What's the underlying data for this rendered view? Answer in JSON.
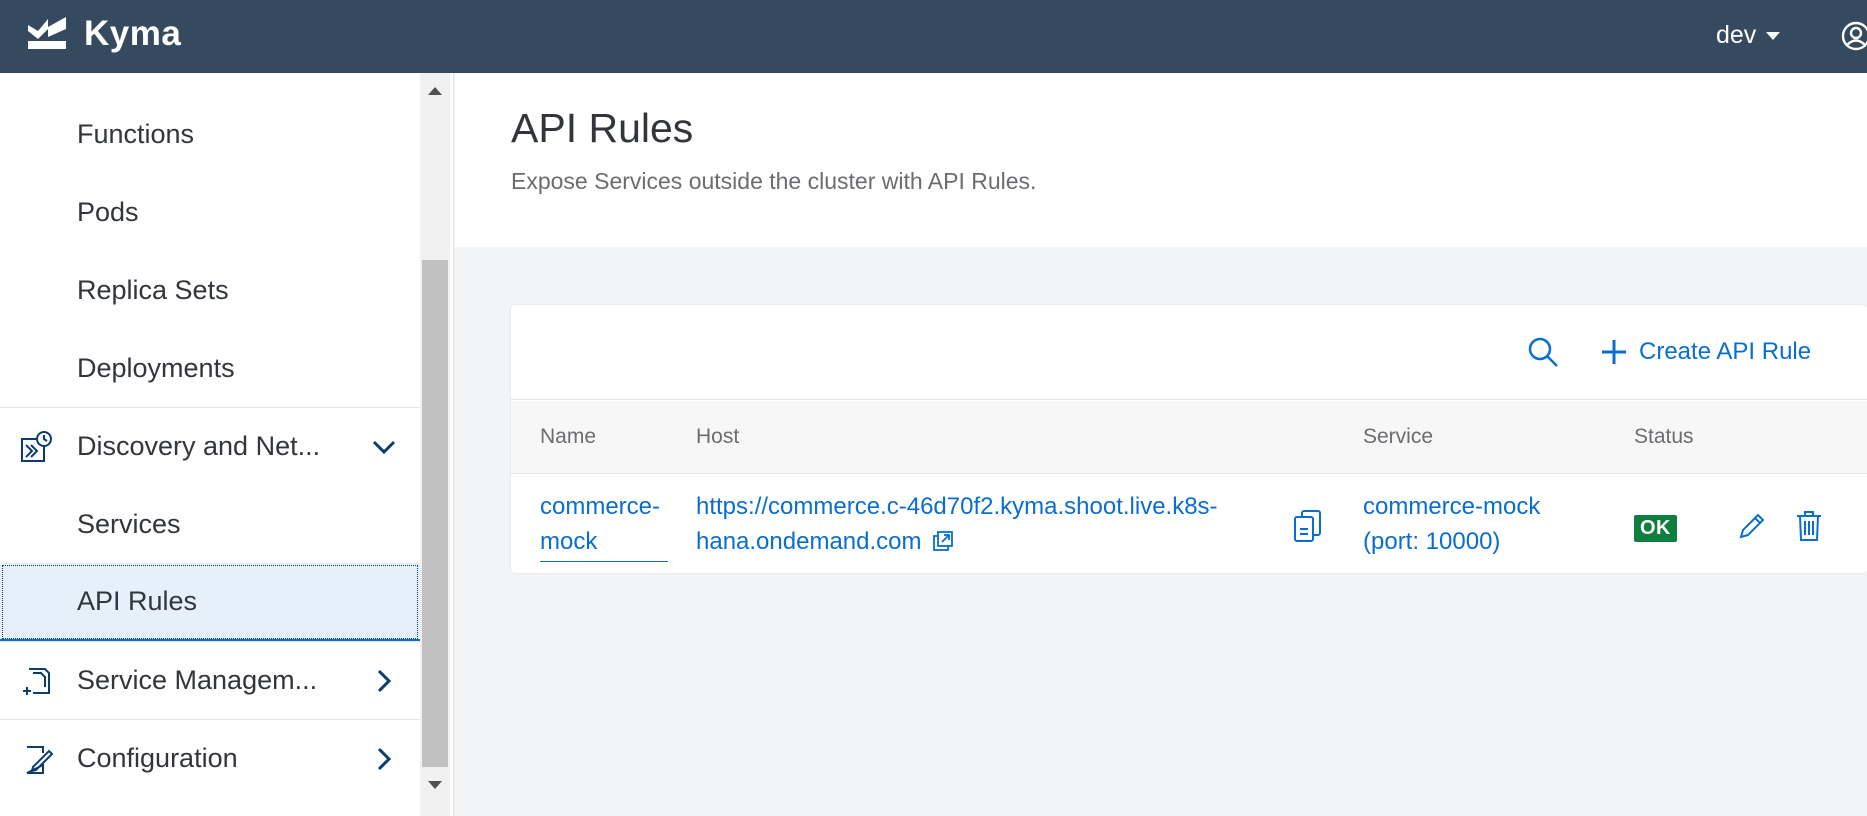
{
  "shell": {
    "app_name": "Kyma",
    "namespace": "dev"
  },
  "sidebar": {
    "items": [
      {
        "label": "Functions"
      },
      {
        "label": "Pods"
      },
      {
        "label": "Replica Sets"
      },
      {
        "label": "Deployments"
      },
      {
        "label": "Discovery and Net...",
        "icon": "discovery-network-icon",
        "expanded": true
      },
      {
        "label": "Services"
      },
      {
        "label": "API Rules",
        "selected": true
      },
      {
        "label": "Service Managem...",
        "icon": "service-management-icon",
        "expanded": false
      },
      {
        "label": "Configuration",
        "icon": "configuration-icon",
        "expanded": false
      }
    ]
  },
  "page": {
    "title": "API Rules",
    "description": "Expose Services outside the cluster with API Rules."
  },
  "toolbar": {
    "create_label": "Create API Rule"
  },
  "table": {
    "columns": [
      "Name",
      "Host",
      "Service",
      "Status"
    ],
    "rows": [
      {
        "name_line1": "commerce-",
        "name_line2": "mock",
        "host_line1": "https://commerce.c-46d70f2.kyma.shoot.live.k8s-",
        "host_line2": "hana.ondemand.com",
        "service_line1": "commerce-mock",
        "service_line2": "(port: 10000)",
        "status": "OK"
      }
    ]
  },
  "colors": {
    "shellbar": "#354a5f",
    "link": "#0a6ed1",
    "status_ok": "#107e3e",
    "selected_bg": "#e5f0fa"
  }
}
